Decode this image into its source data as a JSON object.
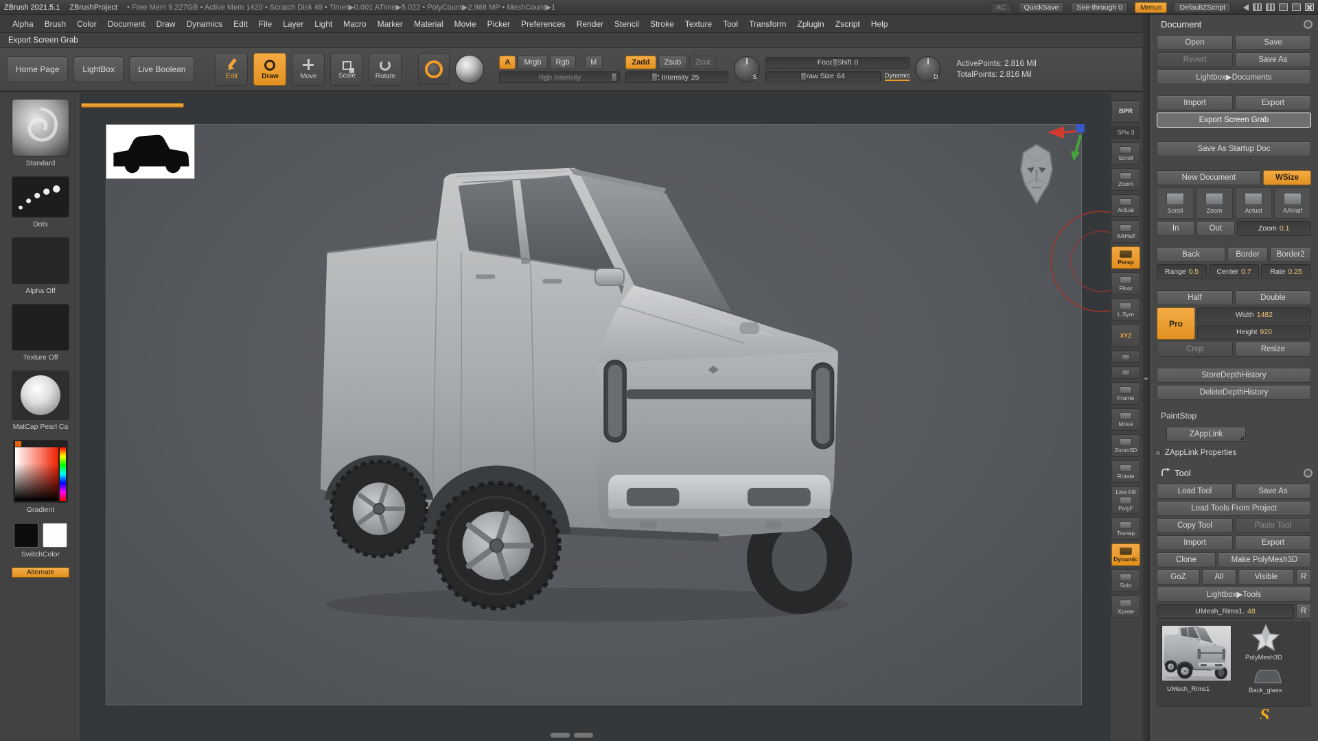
{
  "titlebar": {
    "app_title": "ZBrush 2021.5.1",
    "project": "ZBrushProject",
    "stats": "• Free Mem 9.227GB • Active Mem 1420 • Scratch Disk 49 • Timer▶0.001 ATime▶5.022 • PolyCount▶2.968 MP • MeshCount▶1",
    "ac": "AC",
    "quicksave": "QuickSave",
    "see_through": {
      "label": "See-through",
      "value": "0"
    },
    "menus": "Menus",
    "zscript": "DefaultZScript"
  },
  "menubar": {
    "items": [
      "Alpha",
      "Brush",
      "Color",
      "Document",
      "Draw",
      "Dynamics",
      "Edit",
      "File",
      "Layer",
      "Light",
      "Macro",
      "Marker",
      "Material",
      "Movie",
      "Picker",
      "Preferences",
      "Render",
      "Stencil",
      "Stroke",
      "Texture",
      "Tool",
      "Transform",
      "Zplugin",
      "Zscript",
      "Help"
    ]
  },
  "hint_text": "Export Screen Grab",
  "toolbar": {
    "home_page": "Home Page",
    "lightbox": "LightBox",
    "live_boolean": "Live Boolean",
    "edit": "Edit",
    "draw": "Draw",
    "move": "Move",
    "scale": "Scale",
    "rotate": "Rotate",
    "a": "A",
    "mrgb": "Mrgb",
    "rgb": "Rgb",
    "m": "M",
    "zadd": "Zadd",
    "zsub": "Zsub",
    "zcut": "Zcut",
    "rgb_intensity": {
      "label": "Rgb Intensity"
    },
    "z_intensity": {
      "label": "Z Intensity",
      "value": "25"
    },
    "focal_shift": {
      "label": "Focal Shift",
      "value": "0"
    },
    "draw_size": {
      "label": "Draw Size",
      "value": "64"
    },
    "dynamic": "Dynamic",
    "dial_s": "S",
    "dial_d": "D",
    "active_points": "ActivePoints: 2.816 Mil",
    "total_points": "TotalPoints: 2.816 Mil"
  },
  "left_tray": {
    "brush": "Standard",
    "stroke": "Dots",
    "alpha": "Alpha Off",
    "texture": "Texture Off",
    "material": "MatCap Pearl Ca",
    "gradient": "Gradient",
    "switch_color": "SwitchColor",
    "alternate": "Alternate"
  },
  "right_strip": {
    "bpr": "BPR",
    "spix": {
      "label": "SPix",
      "value": "3"
    },
    "scroll": "Scroll",
    "zoom": "Zoom",
    "actual": "Actual",
    "aahalf": "AAHalf",
    "persp": "Persp",
    "floor": "Floor",
    "lsym": "L.Sym",
    "xyz": "XYZ",
    "frame": "Frame",
    "move": "Move",
    "zoom3d": "Zoom3D",
    "rotate": "Rotate",
    "line_fill": "Line Fill",
    "polyf": "PolyF",
    "transp": "Transp",
    "dynamic": "Dynamic",
    "solo": "Solo",
    "xpose": "Xpose"
  },
  "document_panel": {
    "title": "Document",
    "open": "Open",
    "save": "Save",
    "revert": "Revert",
    "save_as": "Save As",
    "lightbox_documents": "Lightbox▶Documents",
    "import": "Import",
    "export": "Export",
    "export_screen_grab": "Export Screen Grab",
    "save_startup": "Save As Startup Doc",
    "new_document": "New Document",
    "wsize": "WSize",
    "nav": {
      "scroll": "Scroll",
      "zoom": "Zoom",
      "actual": "Actual",
      "aahalf": "AAHalf"
    },
    "zoom_in": "In",
    "zoom_out": "Out",
    "zoom": {
      "label": "Zoom",
      "value": "0.1"
    },
    "back": "Back",
    "border": "Border",
    "border2": "Border2",
    "range": {
      "label": "Range",
      "value": "0.5"
    },
    "center": {
      "label": "Center",
      "value": "0.7"
    },
    "rate": {
      "label": "Rate",
      "value": "0.25"
    },
    "half": "Half",
    "double": "Double",
    "pro": "Pro",
    "width": {
      "label": "Width",
      "value": "1482"
    },
    "height": {
      "label": "Height",
      "value": "920"
    },
    "crop": "Crop",
    "resize": "Resize",
    "store_depth": "StoreDepthHistory",
    "delete_depth": "DeleteDepthHistory",
    "paintstop": "PaintStop",
    "zapplink": "ZAppLink",
    "zapplink_properties": "ZAppLink Properties"
  },
  "tool_panel": {
    "title": "Tool",
    "load_tool": "Load Tool",
    "save_as": "Save As",
    "load_from_project": "Load Tools From Project",
    "copy_tool": "Copy Tool",
    "paste_tool": "Paste Tool",
    "import": "Import",
    "export": "Export",
    "clone": "Clone",
    "make_polymesh": "Make PolyMesh3D",
    "goz": "GoZ",
    "all": "All",
    "visible": "Visible",
    "r": "R",
    "r2": "R",
    "lightbox_tools": "Lightbox▶Tools",
    "active_tool": {
      "name": "UMesh_Rims1.",
      "value": "48"
    },
    "thumbs": {
      "t1": "UMesh_Rims1",
      "t2": "PolyMesh3D",
      "t3": "Back_glass"
    }
  },
  "colors": {
    "accent_orange": "#ee9b26",
    "brush_circle_red": "#a03b30"
  }
}
